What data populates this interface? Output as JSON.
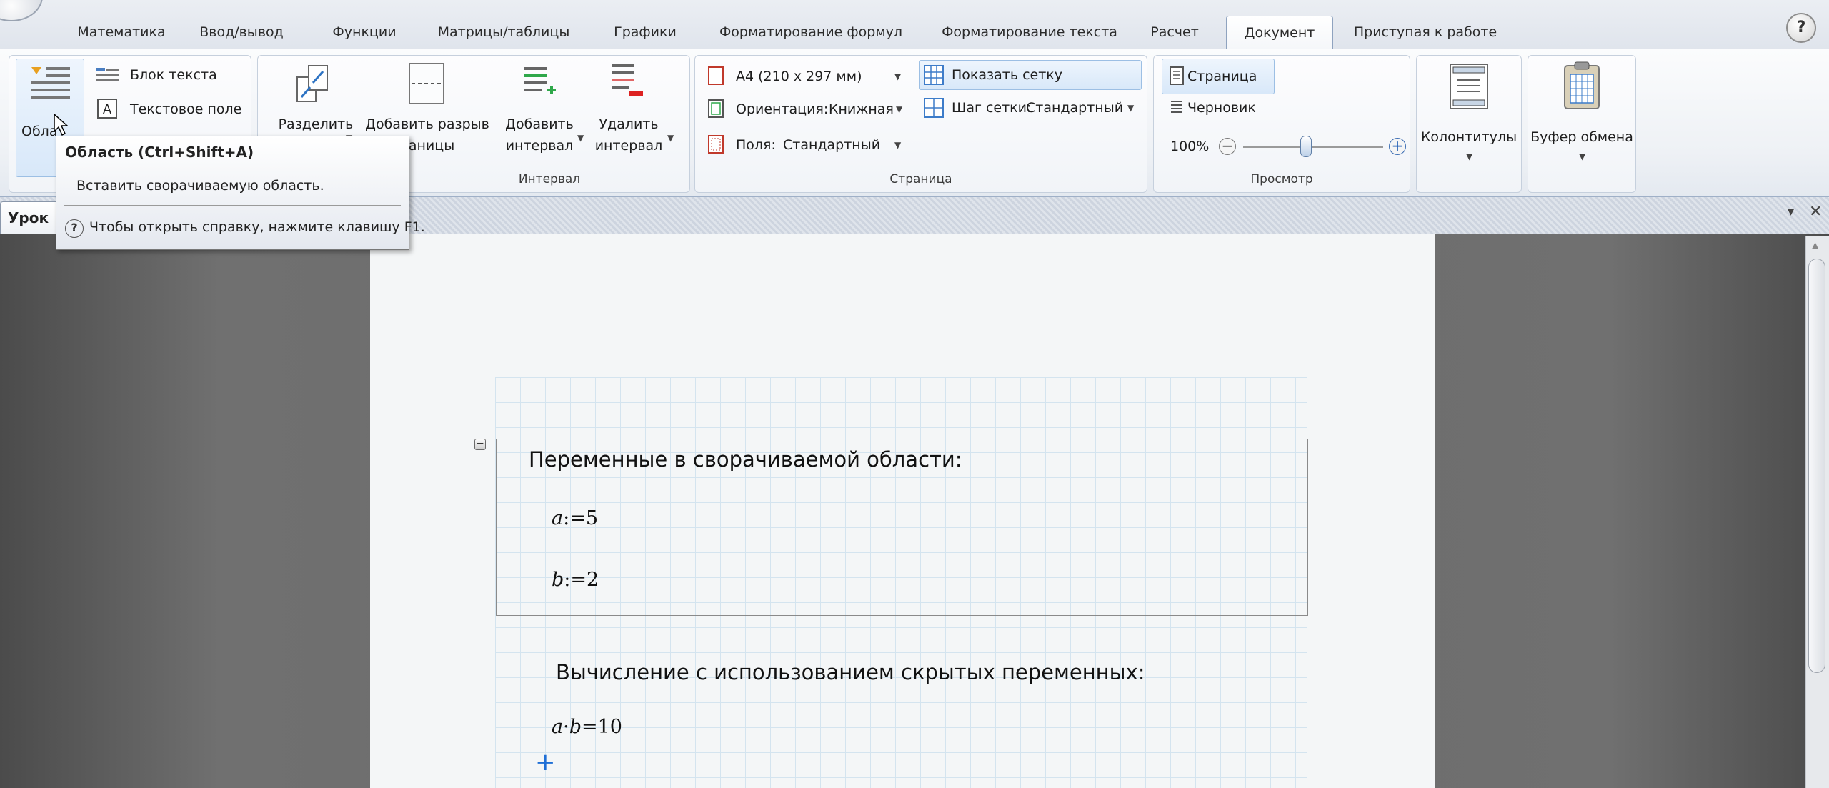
{
  "tabs": [
    {
      "label": "Математика"
    },
    {
      "label": "Ввод/вывод"
    },
    {
      "label": "Функции"
    },
    {
      "label": "Матрицы/таблицы"
    },
    {
      "label": "Графики"
    },
    {
      "label": "Форматирование формул"
    },
    {
      "label": "Форматирование текста"
    },
    {
      "label": "Расчет"
    },
    {
      "label": "Документ"
    },
    {
      "label": "Приступая к работе"
    }
  ],
  "help_label": "?",
  "ribbon": {
    "regions": {
      "region_label": "Обла",
      "text_block": "Блок текста",
      "text_field": "Текстовое поле"
    },
    "interval": {
      "split": "Разделить",
      "add_break_l1": "Добавить разрыв",
      "add_break_l2": "раницы",
      "add_interval_l1": "Добавить",
      "add_interval_l2": "интервал",
      "delete_interval_l1": "Удалить",
      "delete_interval_l2": "интервал",
      "group_label": "Интервал"
    },
    "page": {
      "paper_size": "A4 (210 x 297 мм)",
      "orientation_label": "Ориентация:",
      "orientation_value": "Книжная",
      "margins_label": "Поля:",
      "margins_value": "Стандартный",
      "show_grid": "Показать сетку",
      "grid_step_label": "Шаг сетки:",
      "grid_step_value": "Стандартный",
      "group_label": "Страница"
    },
    "view": {
      "page_mode": "Страница",
      "draft_mode": "Черновик",
      "zoom": "100%",
      "zoom_fraction": 0.45,
      "group_label": "Просмотр"
    },
    "headers_footers": "Колонтитулы",
    "clipboard": "Буфер обмена"
  },
  "tooltip": {
    "title": "Область (Ctrl+Shift+A)",
    "description": "Вставить сворачиваемую область.",
    "help_icon": "?",
    "help": "Чтобы открыть справку, нажмите клавишу F1."
  },
  "doc_tab": {
    "label": "Урок"
  },
  "doc_controls": {
    "dropdown": "▾",
    "close": "✕"
  },
  "worksheet": {
    "collapse_symbol": "−",
    "area_title": "Переменные в сворачиваемой области:",
    "var_a": {
      "name": "a",
      "op": ":=",
      "value": "5"
    },
    "var_b": {
      "name": "b",
      "op": ":=",
      "value": "2"
    },
    "calc_title": "Вычисление с использованием скрытых переменных:",
    "calc": {
      "lhs1": "a",
      "dot": "·",
      "lhs2": "b",
      "eq": "=",
      "value": "10"
    },
    "cursor": "+"
  },
  "colors": {
    "ribbon_accent": "#9cbfe4",
    "cursor": "#1f6fd6",
    "page": "#f4f6f7"
  }
}
